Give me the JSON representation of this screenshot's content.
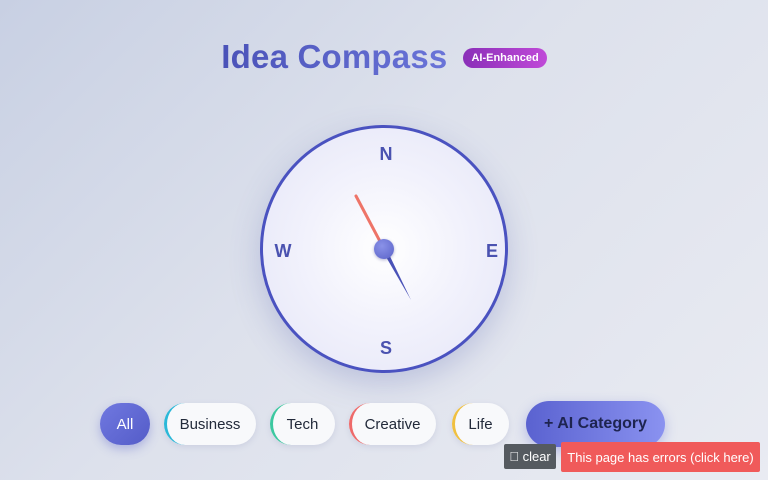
{
  "header": {
    "title": "Idea Compass",
    "badge": "AI-Enhanced"
  },
  "compass": {
    "north": "N",
    "south": "S",
    "west": "W",
    "east": "E",
    "needle_north_color": "#ee7468",
    "needle_south_color": "#4a52b8"
  },
  "categories": [
    {
      "label": "All",
      "active": true,
      "accent": "#5a62c8"
    },
    {
      "label": "Business",
      "active": false,
      "accent": "#2bb8d8"
    },
    {
      "label": "Tech",
      "active": false,
      "accent": "#3cc8a0"
    },
    {
      "label": "Creative",
      "active": false,
      "accent": "#ee6a6a"
    },
    {
      "label": "Life",
      "active": false,
      "accent": "#f0c040"
    }
  ],
  "add_category_label": "+ AI Category",
  "footer": {
    "clear_label": " clear",
    "error_label": "This page has errors (click here)"
  }
}
